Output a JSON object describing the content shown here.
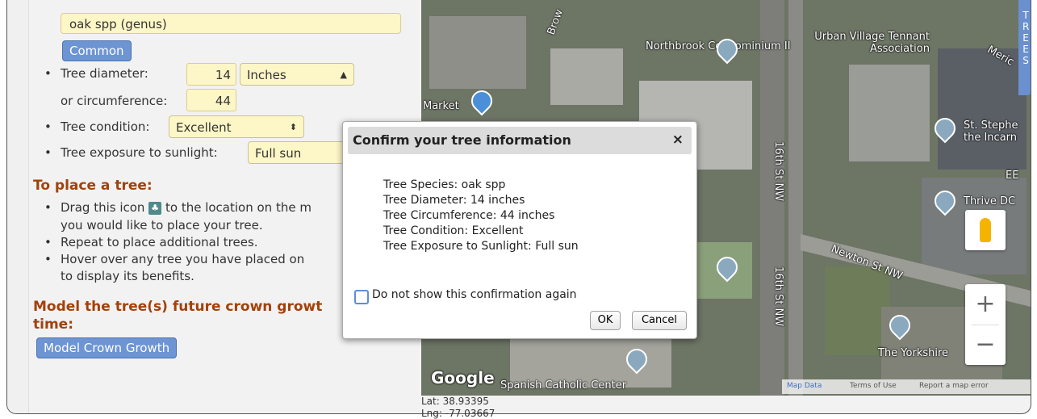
{
  "left_panel": {
    "species_value": "oak spp (genus)",
    "common_button": "Common",
    "diameter_label": "Tree diameter:",
    "diameter_value": "14",
    "diameter_unit": "Inches",
    "circumference_label": "or circumference:",
    "circumference_value": "44",
    "condition_label": "Tree condition:",
    "condition_value": "Excellent",
    "sunlight_label": "Tree exposure to sunlight:",
    "sunlight_value": "Full sun",
    "place_heading": "To place a tree:",
    "place_steps": [
      "Drag this icon",
      "to the location on the m",
      "you would like to place your tree.",
      "Repeat to place additional trees.",
      "Hover over any tree you have placed on",
      "to display its benefits."
    ],
    "model_heading_1": "Model the tree(s) future crown growt",
    "model_heading_2": "time:",
    "model_button": "Model Crown Growth"
  },
  "map": {
    "labels": {
      "northbrook": "Northbrook Condominium II",
      "urban_village": "Urban Village Tennant Association",
      "market": "Market",
      "st_stephen": "St. Stephe the Incarn",
      "thrive": "Thrive DC",
      "newton": "Newton St NW",
      "street_16th_a": "16th St NW",
      "street_16th_b": "16th St NW",
      "yorkshire": "The Yorkshire",
      "spanish": "Spanish Catholic Center",
      "brown": "Brow",
      "merid": "Meric",
      "google": "Google",
      "ee": "EE"
    },
    "footer": {
      "map_data": "Map Data",
      "terms": "Terms of Use",
      "report": "Report a map error"
    },
    "zoom_in": "+",
    "zoom_out": "−",
    "side_tab": "TREES",
    "lat": "Lat: 38.93395",
    "lng": "Lng: -77.03667"
  },
  "dialog": {
    "title": "Confirm your tree information",
    "close": "×",
    "lines": [
      "Tree Species: oak spp",
      "Tree Diameter: 14 inches",
      "Tree Circumference: 44 inches",
      "Tree Condition: Excellent",
      "Tree Exposure to Sunlight: Full sun"
    ],
    "checkbox_label": "Do not show this confirmation again",
    "ok": "OK",
    "cancel": "Cancel"
  },
  "colors": {
    "heading": "#a3410a",
    "button_blue": "#6d94d3",
    "input_yellow": "#fdf6c6"
  }
}
